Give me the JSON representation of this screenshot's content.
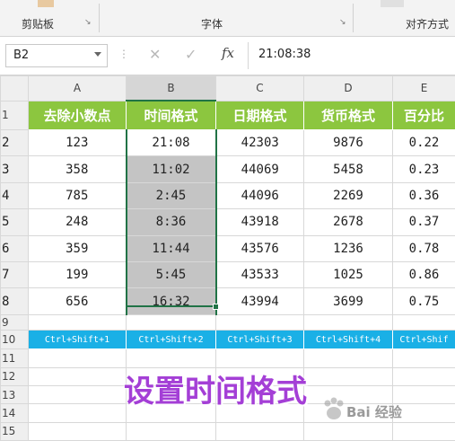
{
  "ribbon": {
    "groups": [
      {
        "label": "剪贴板",
        "launcher": "↘"
      },
      {
        "label": "字体",
        "launcher": "↘"
      },
      {
        "label": "对齐方式"
      }
    ]
  },
  "formula_bar": {
    "name_box": "B2",
    "formula_value": "21:08:38",
    "fx_label": "fx",
    "cancel_glyph": "✕",
    "enter_glyph": "✓"
  },
  "sheet": {
    "column_headers": [
      "A",
      "B",
      "C",
      "D",
      "E"
    ],
    "row_numbers": [
      "1",
      "2",
      "3",
      "4",
      "5",
      "6",
      "7",
      "8",
      "9",
      "10",
      "11",
      "12",
      "13",
      "14",
      "15"
    ],
    "header_row": [
      "去除小数点",
      "时间格式",
      "日期格式",
      "货币格式",
      "百分比"
    ],
    "rows": [
      [
        "123",
        "21:08",
        "42303",
        "9876",
        "0.22"
      ],
      [
        "358",
        "11:02",
        "44069",
        "5458",
        "0.23"
      ],
      [
        "785",
        "2:45",
        "44096",
        "2269",
        "0.36"
      ],
      [
        "248",
        "8:36",
        "43918",
        "2678",
        "0.37"
      ],
      [
        "359",
        "11:44",
        "43576",
        "1236",
        "0.78"
      ],
      [
        "199",
        "5:45",
        "43533",
        "1025",
        "0.86"
      ],
      [
        "656",
        "16:32",
        "43994",
        "3699",
        "0.75"
      ]
    ],
    "shortcut_row": [
      "Ctrl+Shift+1",
      "Ctrl+Shift+2",
      "Ctrl+Shift+3",
      "Ctrl+Shift+4",
      "Ctrl+Shif"
    ],
    "active_cell": "B2",
    "selected_range": "B2:B8",
    "colors": {
      "header_fill": "#8cc63f",
      "shortcut_fill": "#1ab0e6",
      "selection_fill": "#c4c4c4",
      "selection_border": "#217346"
    }
  },
  "overlay": {
    "caption": "设置时间格式",
    "caption_color": "#a43fd6",
    "watermark": "Bai 经验"
  }
}
